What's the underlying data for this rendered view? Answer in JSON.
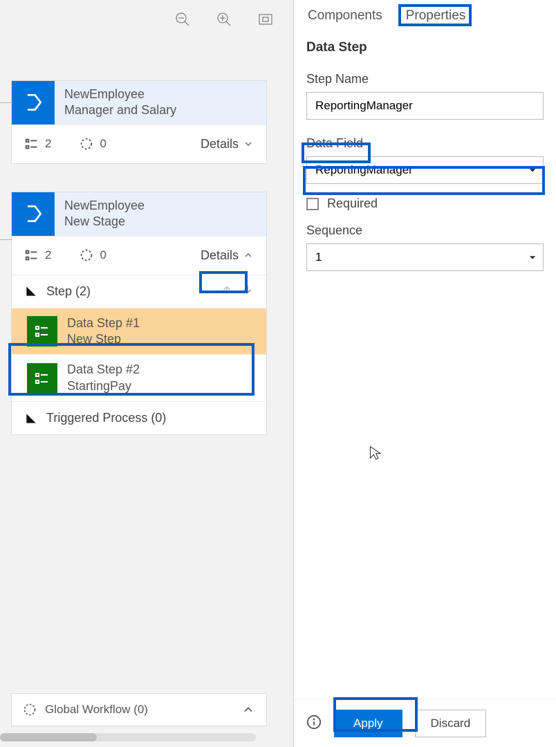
{
  "canvas": {
    "stage1": {
      "entity": "NewEmployee",
      "name": "Manager and Salary",
      "steps_count": "2",
      "process_count": "0",
      "details_label": "Details"
    },
    "stage2": {
      "entity": "NewEmployee",
      "name": "New Stage",
      "steps_count": "2",
      "process_count": "0",
      "details_label": "Details",
      "steps_section_label": "Step (2)",
      "step1_title": "Data Step #1",
      "step1_subtitle": "New Step",
      "step2_title": "Data Step #2",
      "step2_subtitle": "StartingPay",
      "triggered_section_label": "Triggered Process (0)"
    },
    "global_workflow_label": "Global Workflow (0)"
  },
  "tools": {
    "zoom_out": "zoom-out",
    "zoom_in": "zoom-in",
    "fit": "fit-to-screen"
  },
  "panel": {
    "tabs": {
      "components": "Components",
      "properties": "Properties"
    },
    "heading": "Data Step",
    "step_name_label": "Step Name",
    "step_name_value": "ReportingManager",
    "data_field_label": "Data Field",
    "data_field_value": "ReportingManager",
    "required_label": "Required",
    "required_checked": false,
    "sequence_label": "Sequence",
    "sequence_value": "1",
    "apply_label": "Apply",
    "discard_label": "Discard"
  }
}
